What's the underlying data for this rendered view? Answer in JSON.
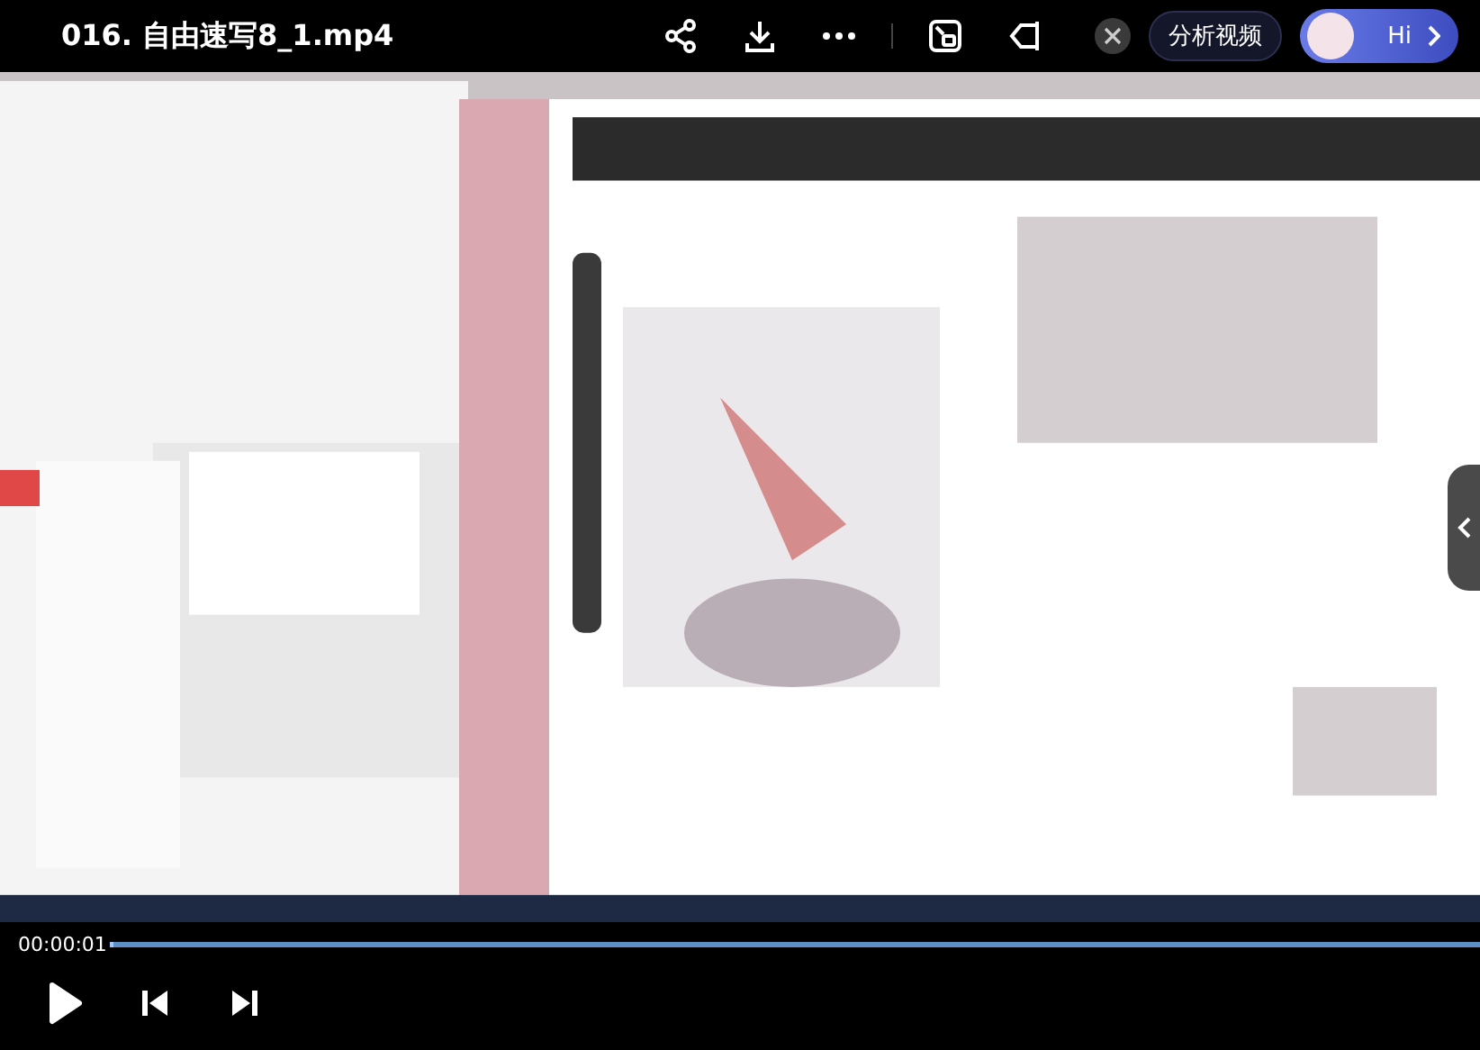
{
  "title_bar": {
    "title": "016.  自由速写8_1.mp4",
    "analyze_button": "分析视频",
    "assistant_greeting": "Hi"
  },
  "controls": {
    "current_time": "00:00:01",
    "progress": {
      "level": 0.002
    }
  }
}
